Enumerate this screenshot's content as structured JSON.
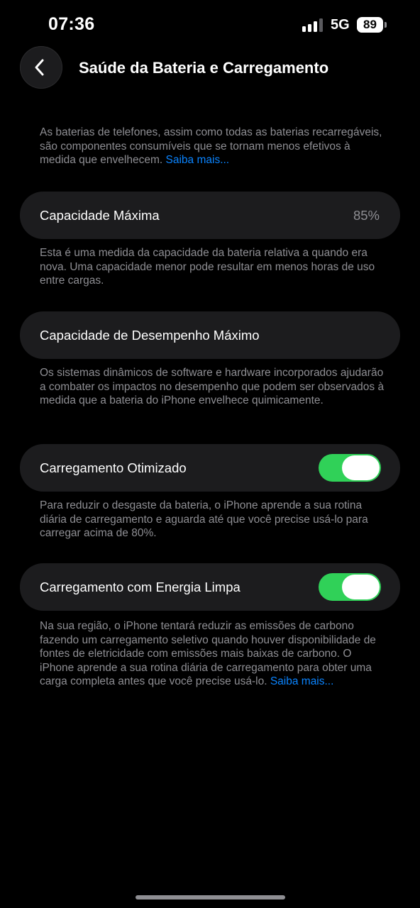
{
  "status_bar": {
    "time": "07:36",
    "network": "5G",
    "battery_level": "89",
    "signal_bars_active": 3,
    "signal_bars_total": 4
  },
  "nav": {
    "back_icon": "chevron-left-icon",
    "title": "Saúde da Bateria e Carregamento"
  },
  "intro": {
    "text": "As baterias de telefones, assim como todas as baterias recarregáveis, são componentes consumíveis que se tornam menos efetivos à medida que envelhecem. ",
    "link": "Saiba mais..."
  },
  "max_capacity": {
    "label": "Capacidade Máxima",
    "value": "85%",
    "footnote": "Esta é uma medida da capacidade da bateria relativa a quando era nova. Uma capacidade menor pode resultar em menos horas de uso entre cargas."
  },
  "peak_performance": {
    "label": "Capacidade de Desempenho Máximo",
    "footnote": "Os sistemas dinâmicos de software e hardware incorporados ajudarão a combater os impactos no desempenho que podem ser observados à medida que a bateria do iPhone envelhece quimicamente."
  },
  "optimized_charging": {
    "label": "Carregamento Otimizado",
    "enabled": true,
    "footnote": "Para reduzir o desgaste da bateria, o iPhone aprende a sua rotina diária de carregamento e aguarda até que você precise usá-lo para carregar acima de 80%."
  },
  "clean_energy_charging": {
    "label": "Carregamento com Energia Limpa",
    "enabled": true,
    "footnote": "Na sua região, o iPhone tentará reduzir as emissões de carbono fazendo um carregamento seletivo quando houver disponibilidade de fontes de eletricidade com emissões mais baixas de carbono. O iPhone aprende a sua rotina diária de carregamento para obter uma carga completa antes que você precise usá-lo. ",
    "link": "Saiba mais..."
  },
  "colors": {
    "background": "#000000",
    "cell": "#1c1c1e",
    "secondary_text": "#8e8e93",
    "link": "#0a84ff",
    "toggle_on": "#30d158"
  }
}
